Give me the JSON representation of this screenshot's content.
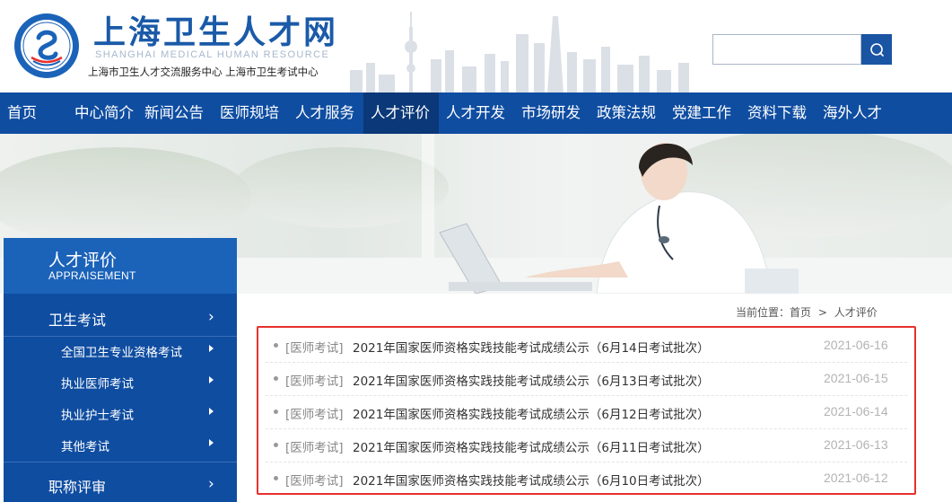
{
  "header": {
    "site_title": "上海卫生人才网",
    "site_subtitle": "SHANGHAI MEDICAL HUMAN RESOURCE",
    "site_org": "上海市卫生人才交流服务中心  上海市卫生考试中心",
    "logo_icon": "emblem-logo-icon",
    "search": {
      "value": "",
      "placeholder": "",
      "button_icon": "search-icon"
    }
  },
  "nav": {
    "items": [
      {
        "label": "首页"
      },
      {
        "label": "中心简介"
      },
      {
        "label": "新闻公告"
      },
      {
        "label": "医师规培"
      },
      {
        "label": "人才服务"
      },
      {
        "label": "人才评价",
        "active": true
      },
      {
        "label": "人才开发"
      },
      {
        "label": "市场研发"
      },
      {
        "label": "政策法规"
      },
      {
        "label": "党建工作"
      },
      {
        "label": "资料下载"
      },
      {
        "label": "海外人才"
      }
    ]
  },
  "sidebar": {
    "title_cn": "人才评价",
    "title_en": "APPRAISEMENT",
    "items": [
      {
        "label": "卫生考试"
      },
      {
        "label": "全国卫生专业资格考试"
      },
      {
        "label": "执业医师考试"
      },
      {
        "label": "执业护士考试"
      },
      {
        "label": "其他考试"
      },
      {
        "label": "职称评审"
      }
    ]
  },
  "breadcrumb": {
    "prefix": "当前位置：",
    "home": "首页",
    "separator": ">",
    "current": "人才评价"
  },
  "news": [
    {
      "category": "[医师考试]",
      "title": "2021年国家医师资格实践技能考试成绩公示（6月14日考试批次）",
      "date": "2021-06-16"
    },
    {
      "category": "[医师考试]",
      "title": "2021年国家医师资格实践技能考试成绩公示（6月13日考试批次）",
      "date": "2021-06-15"
    },
    {
      "category": "[医师考试]",
      "title": "2021年国家医师资格实践技能考试成绩公示（6月12日考试批次）",
      "date": "2021-06-14"
    },
    {
      "category": "[医师考试]",
      "title": "2021年国家医师资格实践技能考试成绩公示（6月11日考试批次）",
      "date": "2021-06-13"
    },
    {
      "category": "[医师考试]",
      "title": "2021年国家医师资格实践技能考试成绩公示（6月10日考试批次）",
      "date": "2021-06-12"
    }
  ],
  "colors": {
    "brand_blue": "#0f4da1",
    "nav_active": "#0a3878",
    "sidebar_title": "#1b63b9",
    "highlight_border": "#e8302e"
  }
}
